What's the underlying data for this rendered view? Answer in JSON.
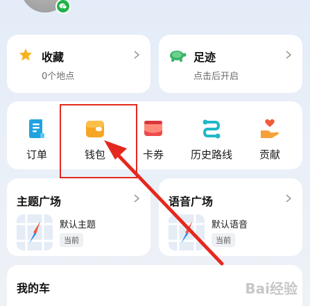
{
  "favorites": {
    "title": "收藏",
    "subtitle": "0个地点"
  },
  "footprints": {
    "title": "足迹",
    "subtitle": "点击后开启"
  },
  "quick_actions": [
    {
      "label": "订单",
      "icon": "order-icon"
    },
    {
      "label": "钱包",
      "icon": "wallet-icon"
    },
    {
      "label": "卡券",
      "icon": "coupon-icon"
    },
    {
      "label": "历史路线",
      "icon": "route-history-icon"
    },
    {
      "label": "贡献",
      "icon": "contribution-icon"
    }
  ],
  "theme_square": {
    "title": "主题广场",
    "item_label": "默认主题",
    "tag": "当前"
  },
  "voice_square": {
    "title": "语音广场",
    "item_label": "默认语音",
    "tag": "当前"
  },
  "my_car": {
    "title": "我的车"
  },
  "watermark": "Bai经验",
  "colors": {
    "accent_red": "#e5281e",
    "wallet_orange": "#f6a623",
    "card_bg": "#ffffff"
  }
}
